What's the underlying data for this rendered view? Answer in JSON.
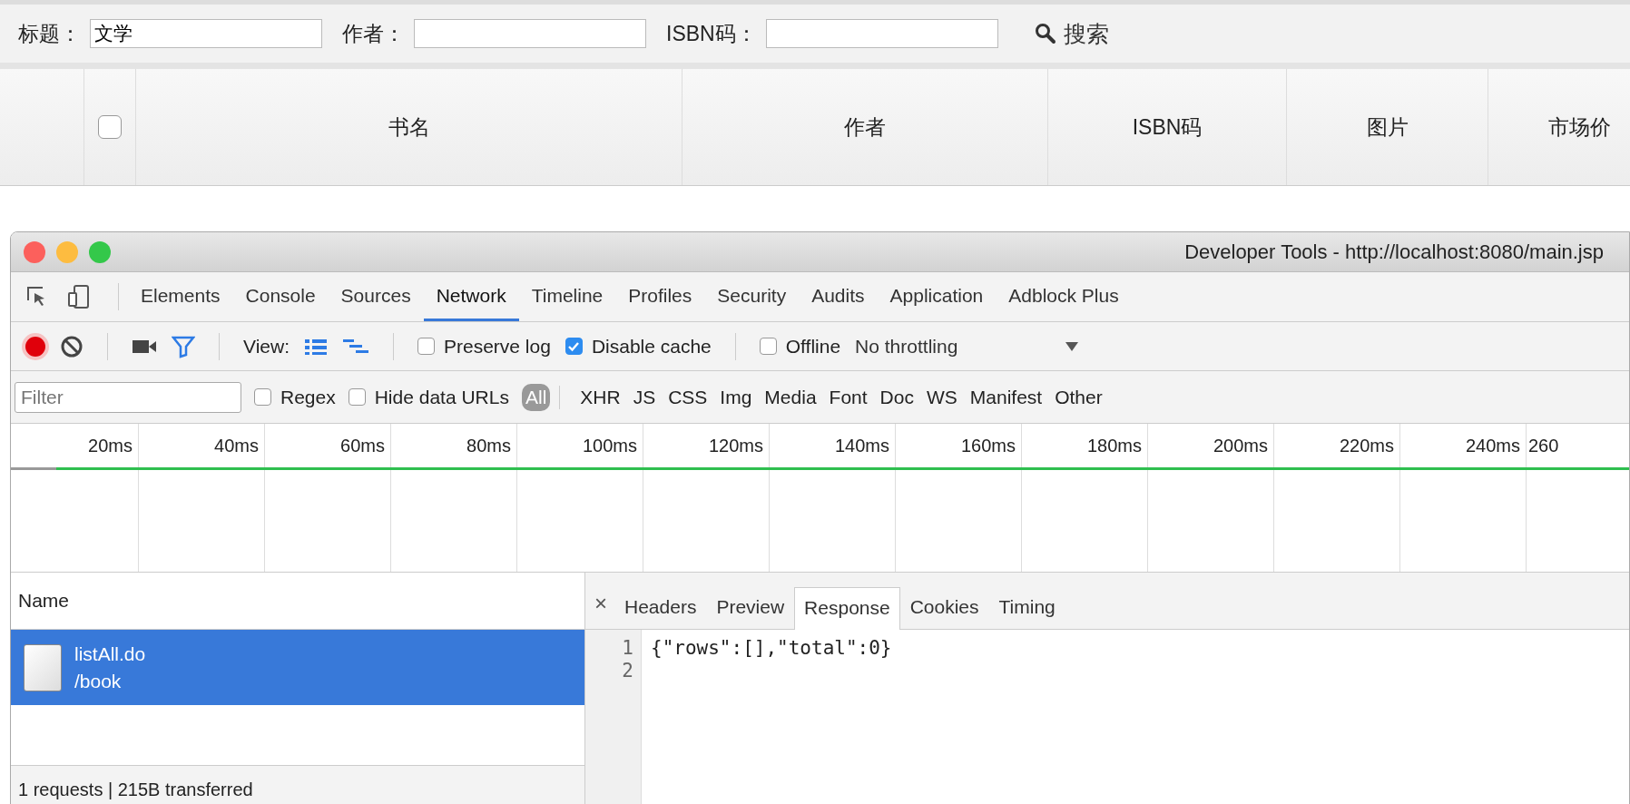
{
  "search_form": {
    "fields": [
      {
        "label": "标题：",
        "value": "文学"
      },
      {
        "label": "作者："
      },
      {
        "label": "ISBN码："
      }
    ],
    "search_button": "搜索"
  },
  "table": {
    "select_all_checked": false,
    "columns": [
      "书名",
      "作者",
      "ISBN码",
      "图片",
      "市场价"
    ]
  },
  "devtools": {
    "title": "Developer Tools - http://localhost:8080/main.jsp",
    "panel_tabs": [
      {
        "label": "Elements",
        "selected": false
      },
      {
        "label": "Console",
        "selected": false
      },
      {
        "label": "Sources",
        "selected": false
      },
      {
        "label": "Network",
        "selected": true
      },
      {
        "label": "Timeline",
        "selected": false
      },
      {
        "label": "Profiles",
        "selected": false
      },
      {
        "label": "Security",
        "selected": false
      },
      {
        "label": "Audits",
        "selected": false
      },
      {
        "label": "Application",
        "selected": false
      },
      {
        "label": "Adblock Plus",
        "selected": false
      }
    ],
    "toolbar": {
      "recording": true,
      "view_label": "View:",
      "options": [
        {
          "label": "Preserve log",
          "checked": false
        },
        {
          "label": "Disable cache",
          "checked": true
        },
        {
          "label": "Offline",
          "checked": false
        }
      ],
      "throttling": "No throttling"
    },
    "filter": {
      "placeholder": "Filter",
      "options": [
        {
          "label": "Regex",
          "checked": false
        },
        {
          "label": "Hide data URLs",
          "checked": false
        }
      ],
      "types": [
        {
          "label": "All",
          "selected": true
        },
        {
          "label": "XHR",
          "selected": false
        },
        {
          "label": "JS",
          "selected": false
        },
        {
          "label": "CSS",
          "selected": false
        },
        {
          "label": "Img",
          "selected": false
        },
        {
          "label": "Media",
          "selected": false
        },
        {
          "label": "Font",
          "selected": false
        },
        {
          "label": "Doc",
          "selected": false
        },
        {
          "label": "WS",
          "selected": false
        },
        {
          "label": "Manifest",
          "selected": false
        },
        {
          "label": "Other",
          "selected": false
        }
      ]
    },
    "timeline": {
      "ticks": [
        "20ms",
        "40ms",
        "60ms",
        "80ms",
        "100ms",
        "120ms",
        "140ms",
        "160ms",
        "180ms",
        "200ms",
        "220ms",
        "240ms",
        "260"
      ]
    },
    "requests": {
      "column": "Name",
      "items": [
        {
          "name": "listAll.do",
          "path": "/book",
          "selected": true
        }
      ],
      "summary": "1 requests | 215B transferred"
    },
    "detail": {
      "close": "×",
      "tabs": [
        {
          "label": "Headers",
          "selected": false
        },
        {
          "label": "Preview",
          "selected": false
        },
        {
          "label": "Response",
          "selected": true
        },
        {
          "label": "Cookies",
          "selected": false
        },
        {
          "label": "Timing",
          "selected": false
        }
      ],
      "lines": [
        {
          "number": "1",
          "text": "{\"rows\":[],\"total\":0}"
        },
        {
          "number": "2"
        }
      ]
    }
  }
}
